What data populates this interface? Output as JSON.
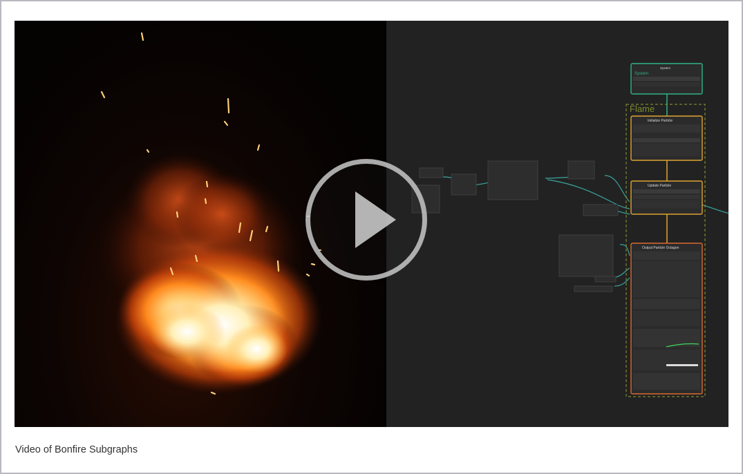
{
  "video": {
    "caption": "Video of Bonfire Subgraphs",
    "play_label": "Play video"
  },
  "graph": {
    "system_title": "System",
    "system_label": "System",
    "flame_context": "Flame",
    "initialize_title": "Initialize Particle",
    "update_title": "Update Particle",
    "output_title": "Output Particle Octagon"
  },
  "colors": {
    "system_border": "#2fb389",
    "context_border": "#e0a531",
    "flame_group": "#7e8a2f",
    "output_border": "#d96b2e",
    "edge": "#3aa6a0"
  }
}
